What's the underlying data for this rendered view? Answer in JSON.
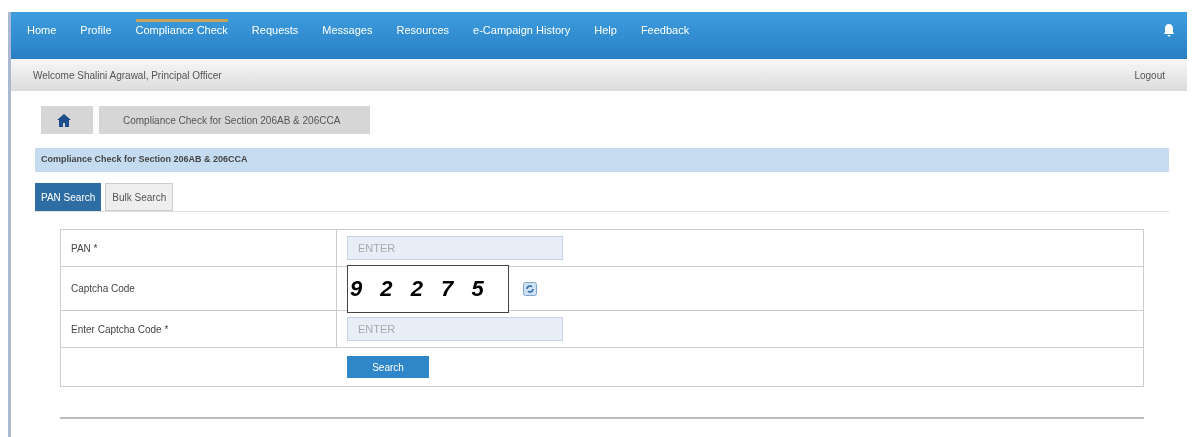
{
  "nav": {
    "items": [
      {
        "label": "Home",
        "selected": false
      },
      {
        "label": "Profile",
        "selected": false
      },
      {
        "label": "Compliance Check",
        "selected": true
      },
      {
        "label": "Requests",
        "selected": false
      },
      {
        "label": "Messages",
        "selected": false
      },
      {
        "label": "Resources",
        "selected": false
      },
      {
        "label": "e-Campaign History",
        "selected": false
      },
      {
        "label": "Help",
        "selected": false
      },
      {
        "label": "Feedback",
        "selected": false
      }
    ]
  },
  "welcome": "Welcome Shalini Agrawal, Principal Officer",
  "logout": "Logout",
  "breadcrumb": [
    "Compliance Check for Section 206AB & 206CCA"
  ],
  "section_title": "Compliance Check for Section 206AB & 206CCA",
  "tabs": [
    {
      "label": "PAN Search",
      "selected": true
    },
    {
      "label": "Bulk Search",
      "selected": false
    }
  ],
  "form": {
    "rows": [
      {
        "kind": "input",
        "label": "PAN *",
        "placeholder": "ENTER"
      },
      {
        "kind": "captcha",
        "label": "Captcha Code",
        "code": "9 2 2 7 5"
      },
      {
        "kind": "input",
        "label": "Enter Captcha Code *",
        "placeholder": "ENTER"
      }
    ],
    "button": "Search"
  }
}
